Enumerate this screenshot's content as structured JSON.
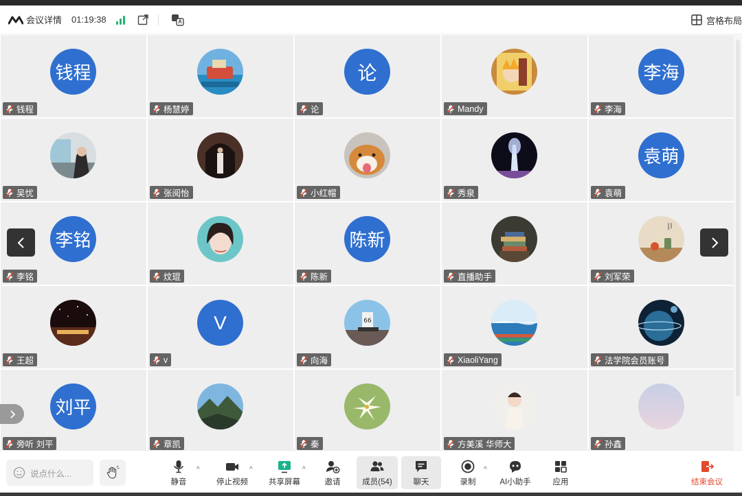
{
  "header": {
    "title": "会议详情",
    "duration": "01:19:38",
    "layout_label": "宫格布局"
  },
  "participants": [
    {
      "name": "钱程",
      "avatar_text": "钱程",
      "photo": null
    },
    {
      "name": "杨慧婷",
      "avatar_text": "",
      "photo": "boat"
    },
    {
      "name": "论",
      "avatar_text": "论",
      "photo": null
    },
    {
      "name": "Mandy",
      "avatar_text": "",
      "photo": "anime"
    },
    {
      "name": "李海",
      "avatar_text": "李海",
      "photo": null
    },
    {
      "name": "吴忧",
      "avatar_text": "",
      "photo": "train-girl"
    },
    {
      "name": "张阅怡",
      "avatar_text": "",
      "photo": "arch"
    },
    {
      "name": "小红帽",
      "avatar_text": "",
      "photo": "dog"
    },
    {
      "name": "秀泉",
      "avatar_text": "",
      "photo": "fountain"
    },
    {
      "name": "袁萌",
      "avatar_text": "袁萌",
      "photo": null
    },
    {
      "name": "李铭",
      "avatar_text": "李铭",
      "photo": null
    },
    {
      "name": "炆琨",
      "avatar_text": "",
      "photo": "woman"
    },
    {
      "name": "陈新",
      "avatar_text": "陈新",
      "photo": null
    },
    {
      "name": "直播助手",
      "avatar_text": "",
      "photo": "books"
    },
    {
      "name": "刘军荣",
      "avatar_text": "",
      "photo": "still-life"
    },
    {
      "name": "王超",
      "avatar_text": "",
      "photo": "night"
    },
    {
      "name": "v",
      "avatar_text": "V",
      "photo": null
    },
    {
      "name": "向海",
      "avatar_text": "",
      "photo": "route66"
    },
    {
      "name": "XiaoliYang",
      "avatar_text": "",
      "photo": "sea"
    },
    {
      "name": "法学院会员账号",
      "avatar_text": "",
      "photo": "planet"
    },
    {
      "name": "旁听 刘平",
      "avatar_text": "刘平",
      "photo": null
    },
    {
      "name": "章凯",
      "avatar_text": "",
      "photo": "mountain"
    },
    {
      "name": "秦",
      "avatar_text": "",
      "photo": "lily"
    },
    {
      "name": "方美溪 华师大",
      "avatar_text": "",
      "photo": "child"
    },
    {
      "name": "孙鑫",
      "avatar_text": "",
      "photo": "haze"
    }
  ],
  "toolbar": {
    "chat_placeholder": "说点什么...",
    "mute": "静音",
    "stop_video": "停止视频",
    "share_screen": "共享屏幕",
    "invite": "邀请",
    "members": "成员(54)",
    "chat": "聊天",
    "record": "录制",
    "ai_assistant": "AI小助手",
    "apps": "应用",
    "end_meeting": "结束会议"
  },
  "colors": {
    "avatar_blue": "#2f6fcf",
    "signal_green": "#22b573",
    "end_red": "#e24a2b",
    "share_green": "#1bb28a"
  }
}
